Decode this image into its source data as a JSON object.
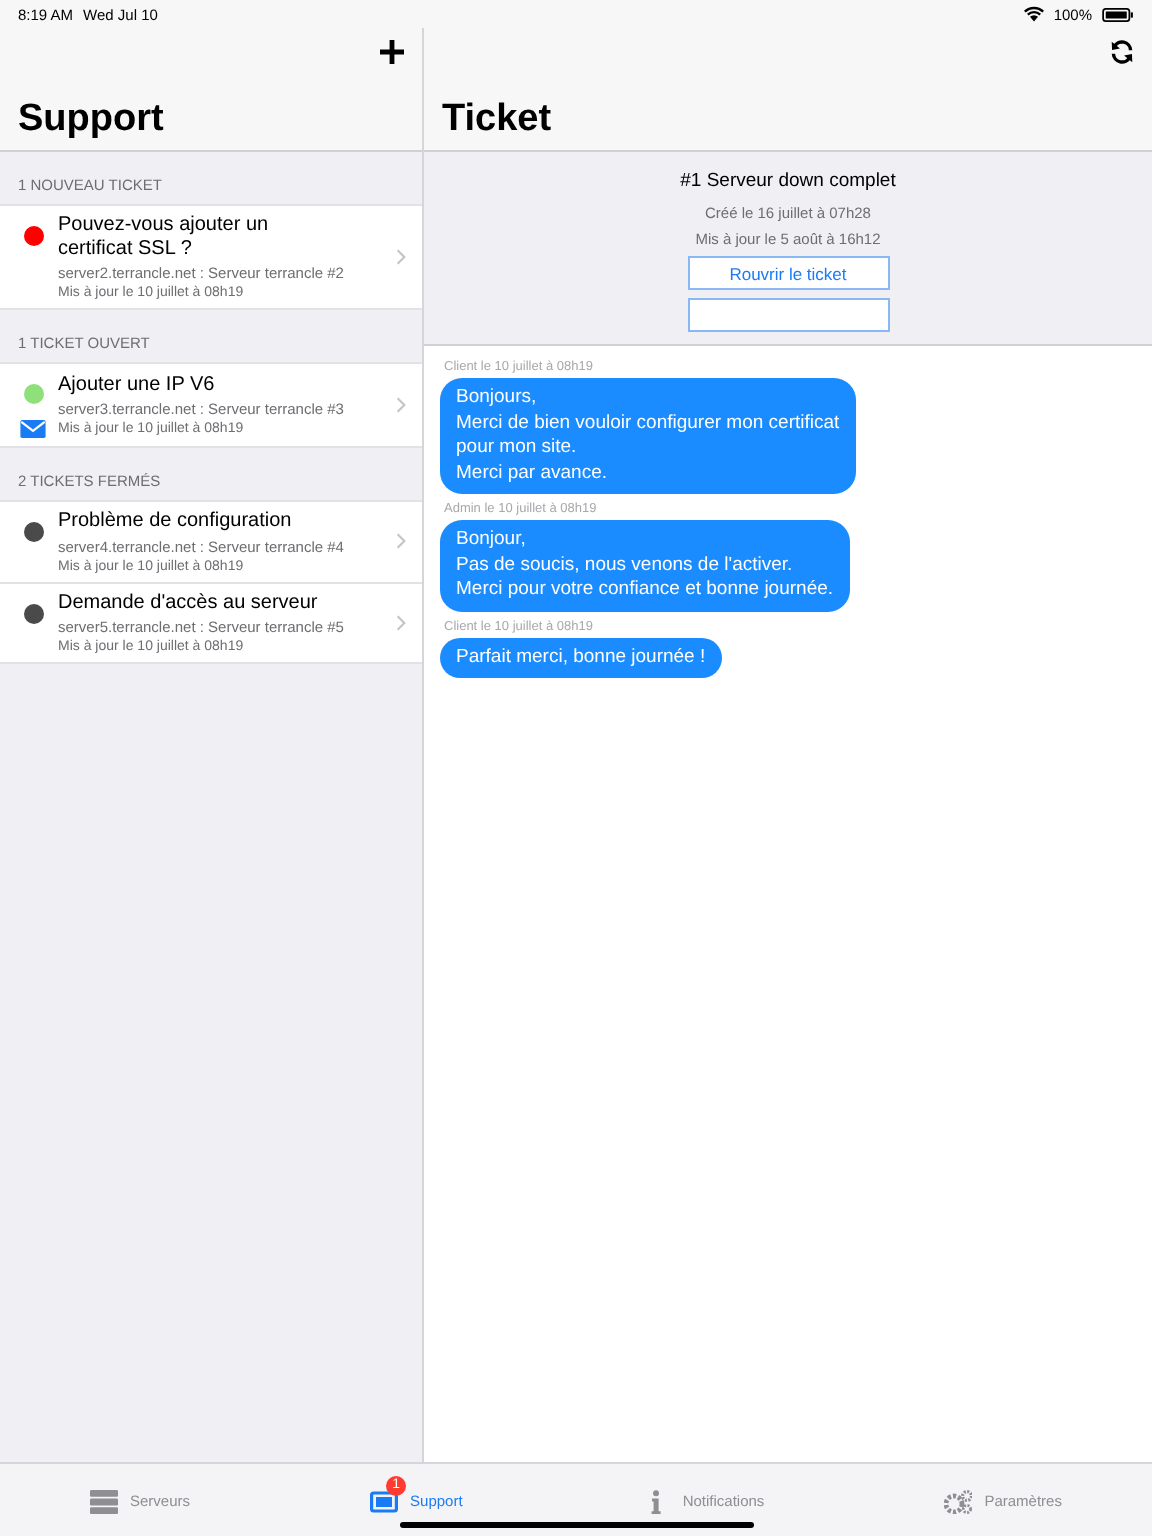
{
  "status_bar": {
    "time": "8:19 AM",
    "date": "Wed Jul 10",
    "battery": "100%"
  },
  "master": {
    "title": "Support",
    "sections": [
      {
        "header": "1 NOUVEAU TICKET",
        "tickets": [
          {
            "title": "Pouvez-vous ajouter un\ncertificat SSL ?",
            "server": "server2.terrancle.net : Serveur terrancle #2",
            "updated": "Mis à jour le 10 juillet à 08h19",
            "color": "#ff0000",
            "unread": false
          }
        ]
      },
      {
        "header": "1 TICKET OUVERT",
        "tickets": [
          {
            "title": "Ajouter une IP V6",
            "server": "server3.terrancle.net : Serveur terrancle #3",
            "updated": "Mis à jour le 10 juillet à 08h19",
            "color": "#8fe07a",
            "unread": true
          }
        ]
      },
      {
        "header": "2 TICKETS FERMÉS",
        "tickets": [
          {
            "title": "Problème de configuration",
            "server": "server4.terrancle.net : Serveur terrancle #4",
            "updated": "Mis à jour le 10 juillet à 08h19",
            "color": "#4a4a4a",
            "unread": false
          },
          {
            "title": "Demande d'accès au serveur",
            "server": "server5.terrancle.net : Serveur terrancle #5",
            "updated": "Mis à jour le 10 juillet à 08h19",
            "color": "#4a4a4a",
            "unread": false
          }
        ]
      }
    ]
  },
  "detail": {
    "title": "Ticket",
    "ticket": {
      "heading": "#1 Serveur down complet",
      "created": "Créé le 16 juillet à 07h28",
      "updated": "Mis à jour le 5 août à 16h12",
      "button": "Rouvrir le ticket"
    },
    "messages": [
      {
        "meta": "Client le 10 juillet à 08h19",
        "text": "Bonjours,\nMerci de bien vouloir configurer mon certificat\npour mon site.\nMerci par avance."
      },
      {
        "meta": "Admin le 10 juillet à 08h19",
        "text": "Bonjour,\nPas de soucis, nous venons de l'activer.\nMerci pour votre confiance et bonne journée."
      },
      {
        "meta": "Client le 10 juillet à 08h19",
        "text": "Parfait merci, bonne journée !"
      }
    ]
  },
  "tabs": [
    {
      "kind": "servers",
      "label": "Serveurs",
      "selected": false
    },
    {
      "kind": "support",
      "label": "Support",
      "selected": true,
      "badge": "1"
    },
    {
      "kind": "info",
      "label": "Notifications",
      "selected": false
    },
    {
      "kind": "settings",
      "label": "Paramètres",
      "selected": false
    }
  ]
}
